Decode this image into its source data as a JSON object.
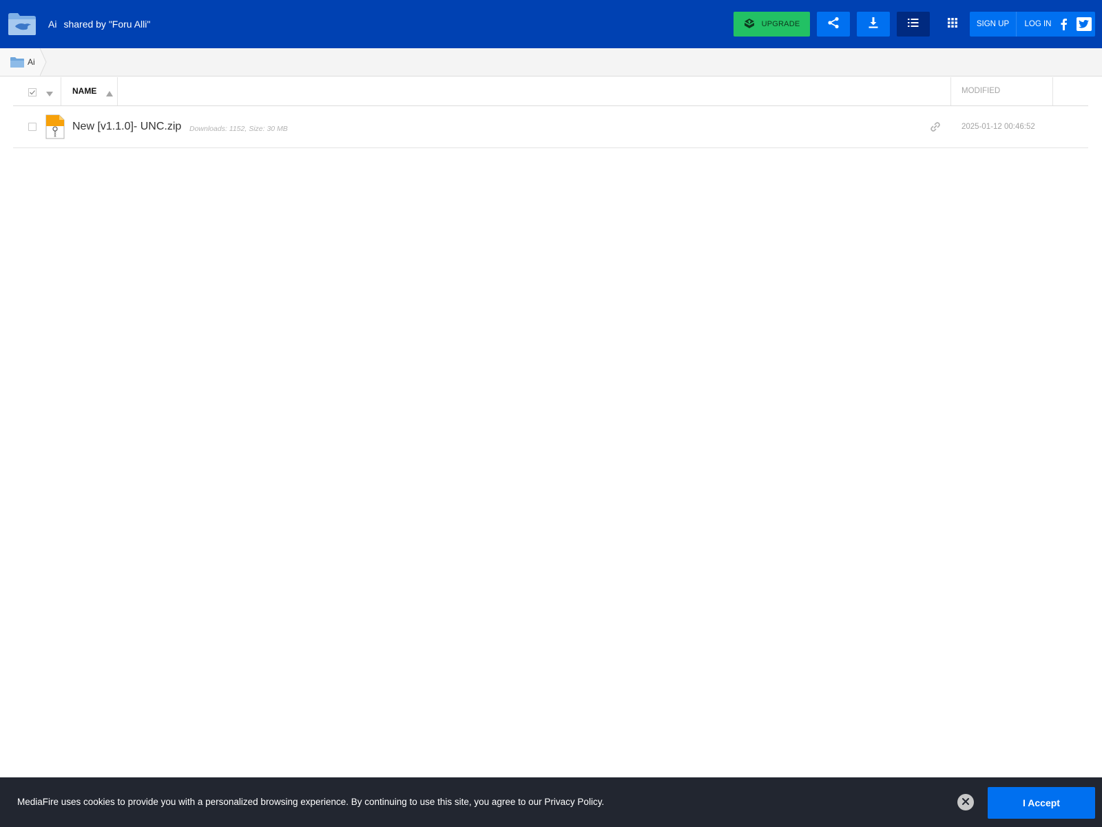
{
  "header": {
    "folder_name": "Ai",
    "shared_by": "shared by \"Foru Alli\"",
    "upgrade_label": "UPGRADE",
    "signup_label": "SIGN UP",
    "login_label": "LOG IN",
    "brand_color": "#0041b2",
    "accent_color": "#0070f0",
    "upgrade_color": "#22c164",
    "icons": [
      "mediafire-logo-icon",
      "upgrade-icon",
      "share-icon",
      "download-icon",
      "list-view-icon",
      "grid-view-icon",
      "facebook-icon",
      "twitter-icon"
    ]
  },
  "breadcrumb": {
    "items": [
      {
        "label": "Ai",
        "icon": "folder-icon"
      }
    ]
  },
  "table": {
    "columns": {
      "name": "NAME",
      "modified": "MODIFIED"
    },
    "sort": {
      "column": "name",
      "direction": "ascending"
    },
    "rows": [
      {
        "name": "New [v1.1.0]- UNC.zip",
        "meta": "Downloads: 1152, Size: 30 MB",
        "modified": "2025-01-12 00:46:52",
        "icon": "zip-file-icon"
      }
    ]
  },
  "cookie_banner": {
    "text": "MediaFire uses cookies to provide you with a personalized browsing experience. By continuing to use this site, you agree to our Privacy Policy.",
    "accept_label": "I Accept",
    "background": "#222630"
  }
}
